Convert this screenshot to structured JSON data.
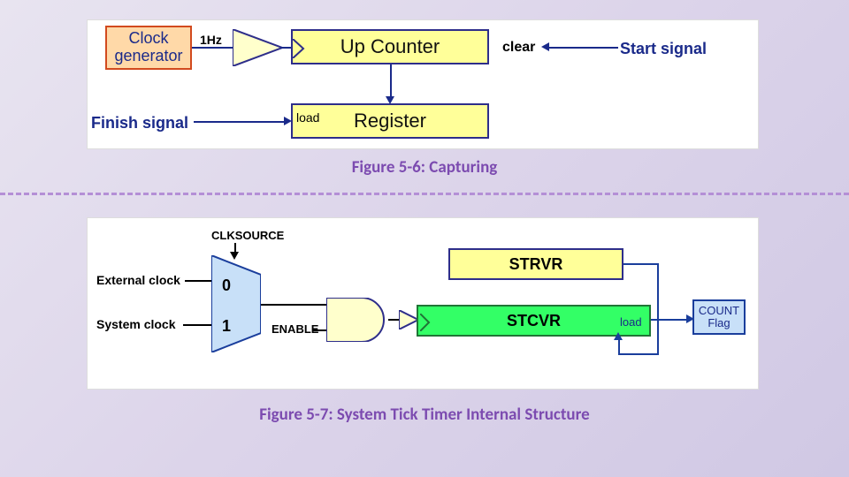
{
  "captions": {
    "top": "Figure 5-6: Capturing",
    "bottom": "Figure 5-7: System Tick Timer Internal Structure"
  },
  "fig_top": {
    "blocks": {
      "clock_generator": "Clock generator",
      "up_counter": "Up Counter",
      "register": "Register"
    },
    "labels": {
      "freq": "1Hz",
      "clear": "clear",
      "start": "Start signal",
      "finish": "Finish signal",
      "load": "load"
    },
    "connections": [
      "clock_generator -> (1Hz) -> triangle buffer -> Up Counter (left, clock input)",
      "Start signal -> Up Counter (right, clear)",
      "Up Counter -> Register (top, data)",
      "Finish signal -> Register (left, load)"
    ]
  },
  "fig_bottom": {
    "labels": {
      "clksource": "CLKSOURCE",
      "external_clock": "External clock",
      "system_clock": "System clock",
      "enable": "ENABLE",
      "load": "load"
    },
    "mux": {
      "inputs": [
        "0",
        "1"
      ],
      "select": "CLKSOURCE"
    },
    "gates": {
      "and_inputs": [
        "mux_output",
        "ENABLE"
      ]
    },
    "blocks": {
      "strvr": "STRVR",
      "stcvr": "STCVR",
      "count_flag": "COUNT Flag"
    },
    "connections": [
      "External clock -> mux.0",
      "System clock -> mux.1",
      "CLKSOURCE -> mux.select (top)",
      "mux.out -> AND.in0",
      "ENABLE -> AND.in1",
      "AND.out -> buffer -> STCVR (left, clock)",
      "STRVR -> STCVR (load, top/right)",
      "STCVR -> COUNT Flag"
    ]
  }
}
